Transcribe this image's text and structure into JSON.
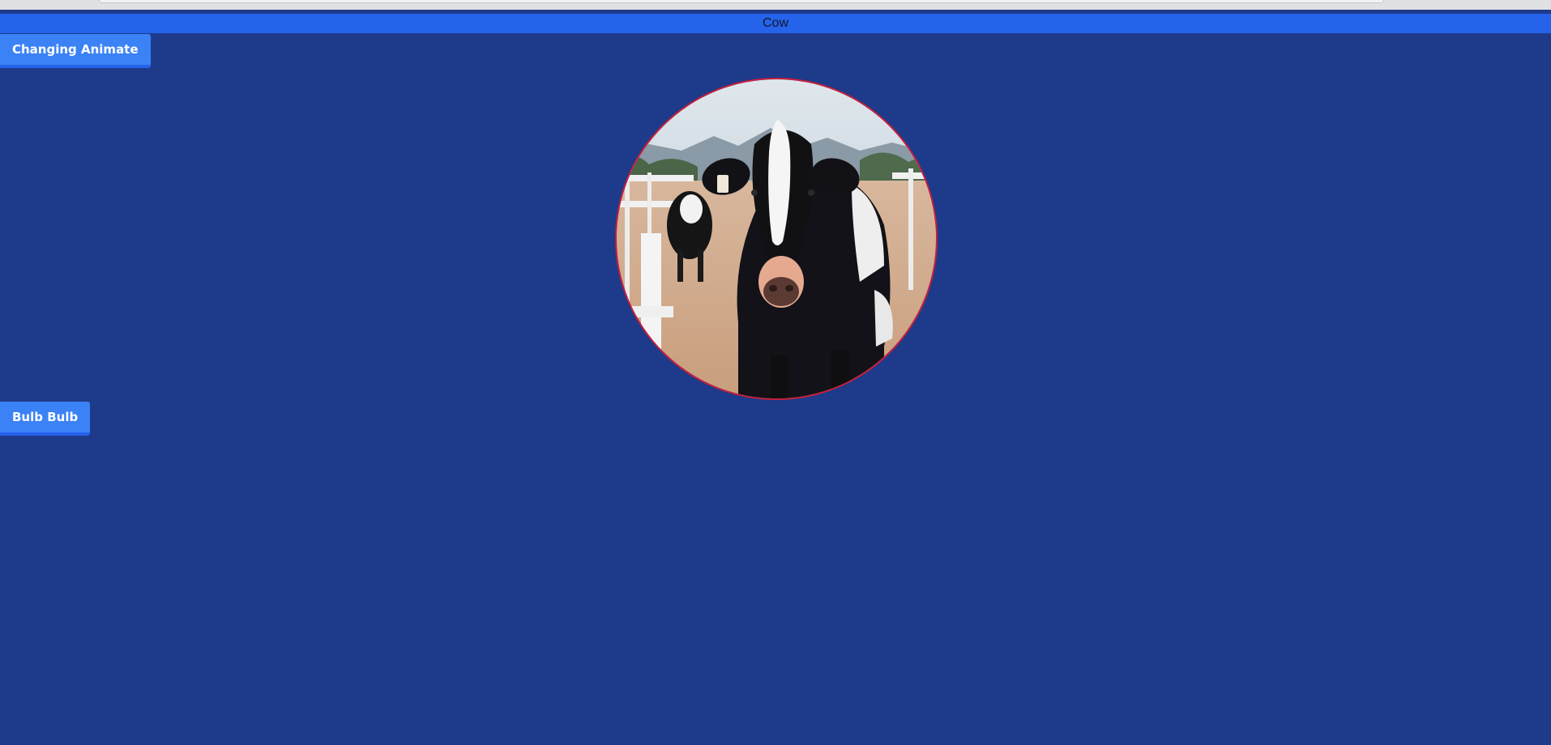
{
  "header": {
    "title": "Cow"
  },
  "buttons": {
    "animate_label": "Changing Animate",
    "bulb_label": "Bulb Bulb"
  },
  "image": {
    "subject": "cow-photo"
  },
  "colors": {
    "page_background": "#1e3a8a",
    "title_bar": "#2563eb",
    "button": "#3b82f6",
    "image_border": "#c81e3a"
  }
}
